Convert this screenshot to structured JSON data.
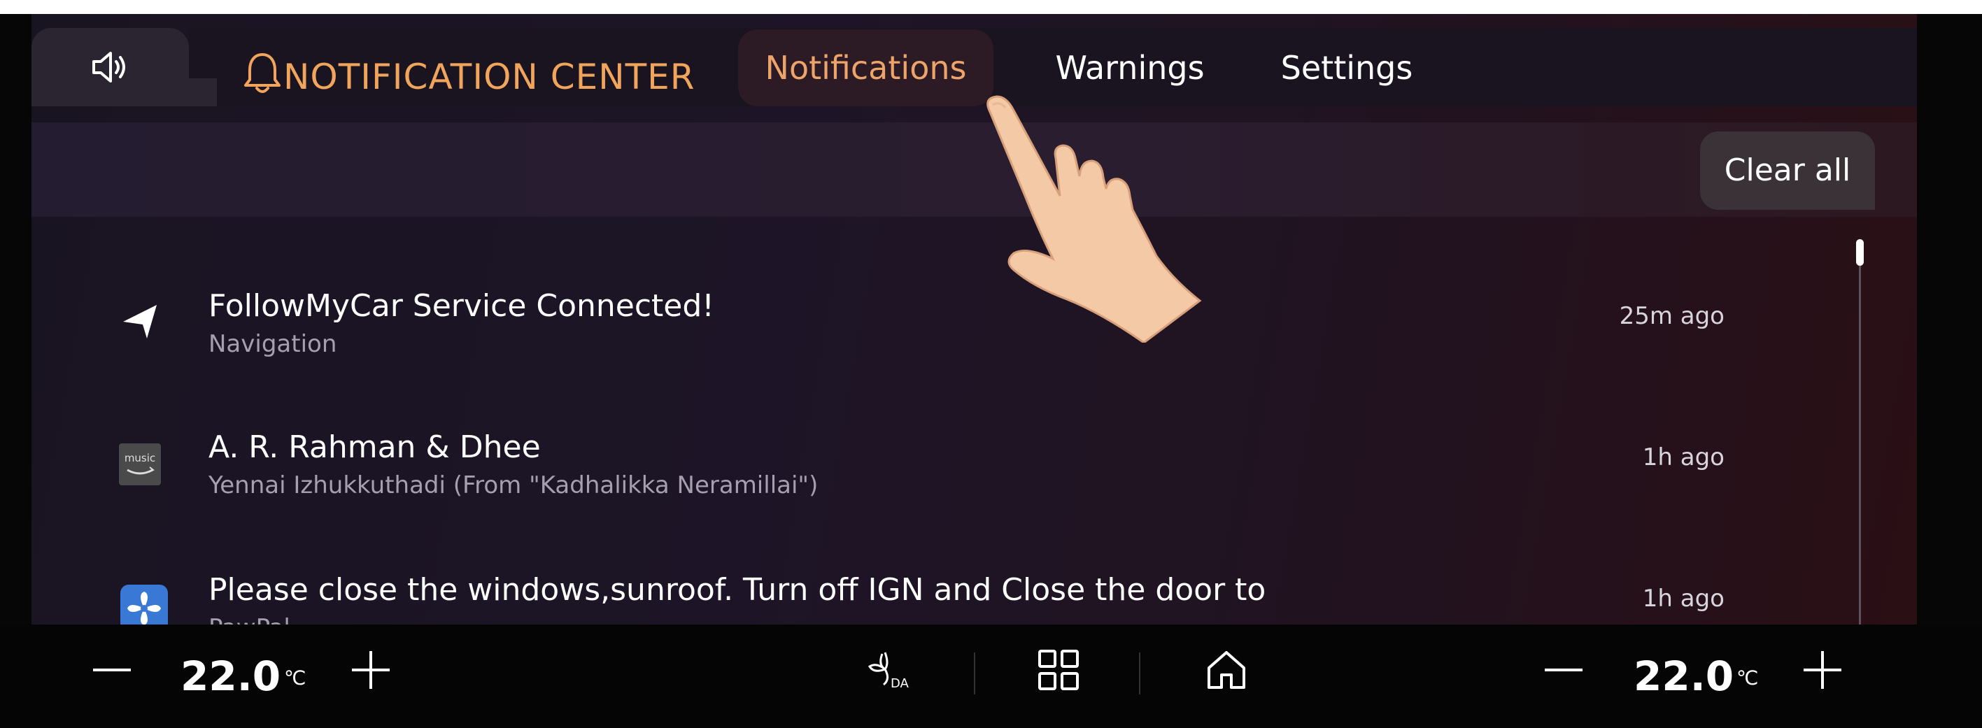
{
  "header": {
    "speaker_icon": "speaker-icon",
    "bell_icon": "bell-icon",
    "title": "NOTIFICATION CENTER",
    "tabs": [
      {
        "label": "Notifications",
        "active": true
      },
      {
        "label": "Warnings",
        "active": false
      },
      {
        "label": "Settings",
        "active": false
      }
    ]
  },
  "clear_all_label": "Clear all",
  "notifications": [
    {
      "icon": "navigation-arrow-icon",
      "title": "FollowMyCar Service Connected!",
      "subtitle": "Navigation",
      "time": "25m ago"
    },
    {
      "icon": "amazon-music-icon",
      "title": "A. R. Rahman & Dhee",
      "subtitle": "Yennai Izhukkuthadi (From \"Kadhalikka Neramillai\")",
      "time": "1h ago"
    },
    {
      "icon": "pawpal-fan-icon",
      "title": "Please close the windows,sunroof. Turn off IGN and Close the door to",
      "subtitle": "PawPal",
      "time": "1h ago"
    }
  ],
  "bottom_bar": {
    "left_temp": "22.0",
    "right_temp": "22.0",
    "unit": "℃"
  },
  "colors": {
    "accent": "#f0a45c",
    "background": "#1d1527",
    "text": "#ffffff"
  }
}
